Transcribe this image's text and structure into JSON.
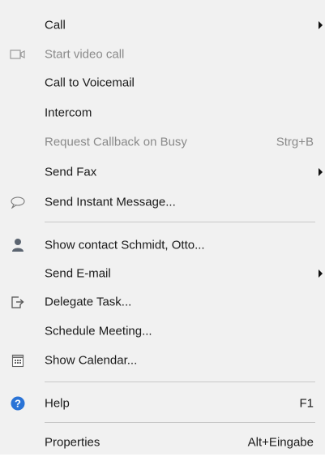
{
  "menu": {
    "items": [
      {
        "label": "Call",
        "shortcut": "",
        "submenu": true,
        "disabled": false,
        "icon": ""
      },
      {
        "label": "Start video call",
        "shortcut": "",
        "submenu": false,
        "disabled": true,
        "icon": "video-camera-icon"
      },
      {
        "label": "Call to Voicemail",
        "shortcut": "",
        "submenu": false,
        "disabled": false,
        "icon": ""
      },
      {
        "label": "Intercom",
        "shortcut": "",
        "submenu": false,
        "disabled": false,
        "icon": ""
      },
      {
        "label": "Request Callback on Busy",
        "shortcut": "Strg+B",
        "submenu": false,
        "disabled": true,
        "icon": ""
      },
      {
        "label": "Send Fax",
        "shortcut": "",
        "submenu": true,
        "disabled": false,
        "icon": ""
      },
      {
        "label": "Send Instant Message...",
        "shortcut": "",
        "submenu": false,
        "disabled": false,
        "icon": "chat-bubble-icon"
      },
      {
        "label": "Show contact Schmidt, Otto...",
        "shortcut": "",
        "submenu": false,
        "disabled": false,
        "icon": "person-icon"
      },
      {
        "label": "Send E-mail",
        "shortcut": "",
        "submenu": true,
        "disabled": false,
        "icon": ""
      },
      {
        "label": "Delegate Task...",
        "shortcut": "",
        "submenu": false,
        "disabled": false,
        "icon": "delegate-task-icon"
      },
      {
        "label": "Schedule Meeting...",
        "shortcut": "",
        "submenu": false,
        "disabled": false,
        "icon": ""
      },
      {
        "label": "Show Calendar...",
        "shortcut": "",
        "submenu": false,
        "disabled": false,
        "icon": "calendar-icon"
      },
      {
        "label": "Help",
        "shortcut": "F1",
        "submenu": false,
        "disabled": false,
        "icon": "help-icon"
      },
      {
        "label": "Properties",
        "shortcut": "Alt+Eingabe",
        "submenu": false,
        "disabled": false,
        "icon": ""
      }
    ]
  },
  "colors": {
    "background": "#f1f1f1",
    "text": "#1a1a1a",
    "disabled_text": "#8a8a8a",
    "separator": "#c8c8c8",
    "help_icon": "#2a73d6",
    "person_icon": "#5b6470"
  }
}
